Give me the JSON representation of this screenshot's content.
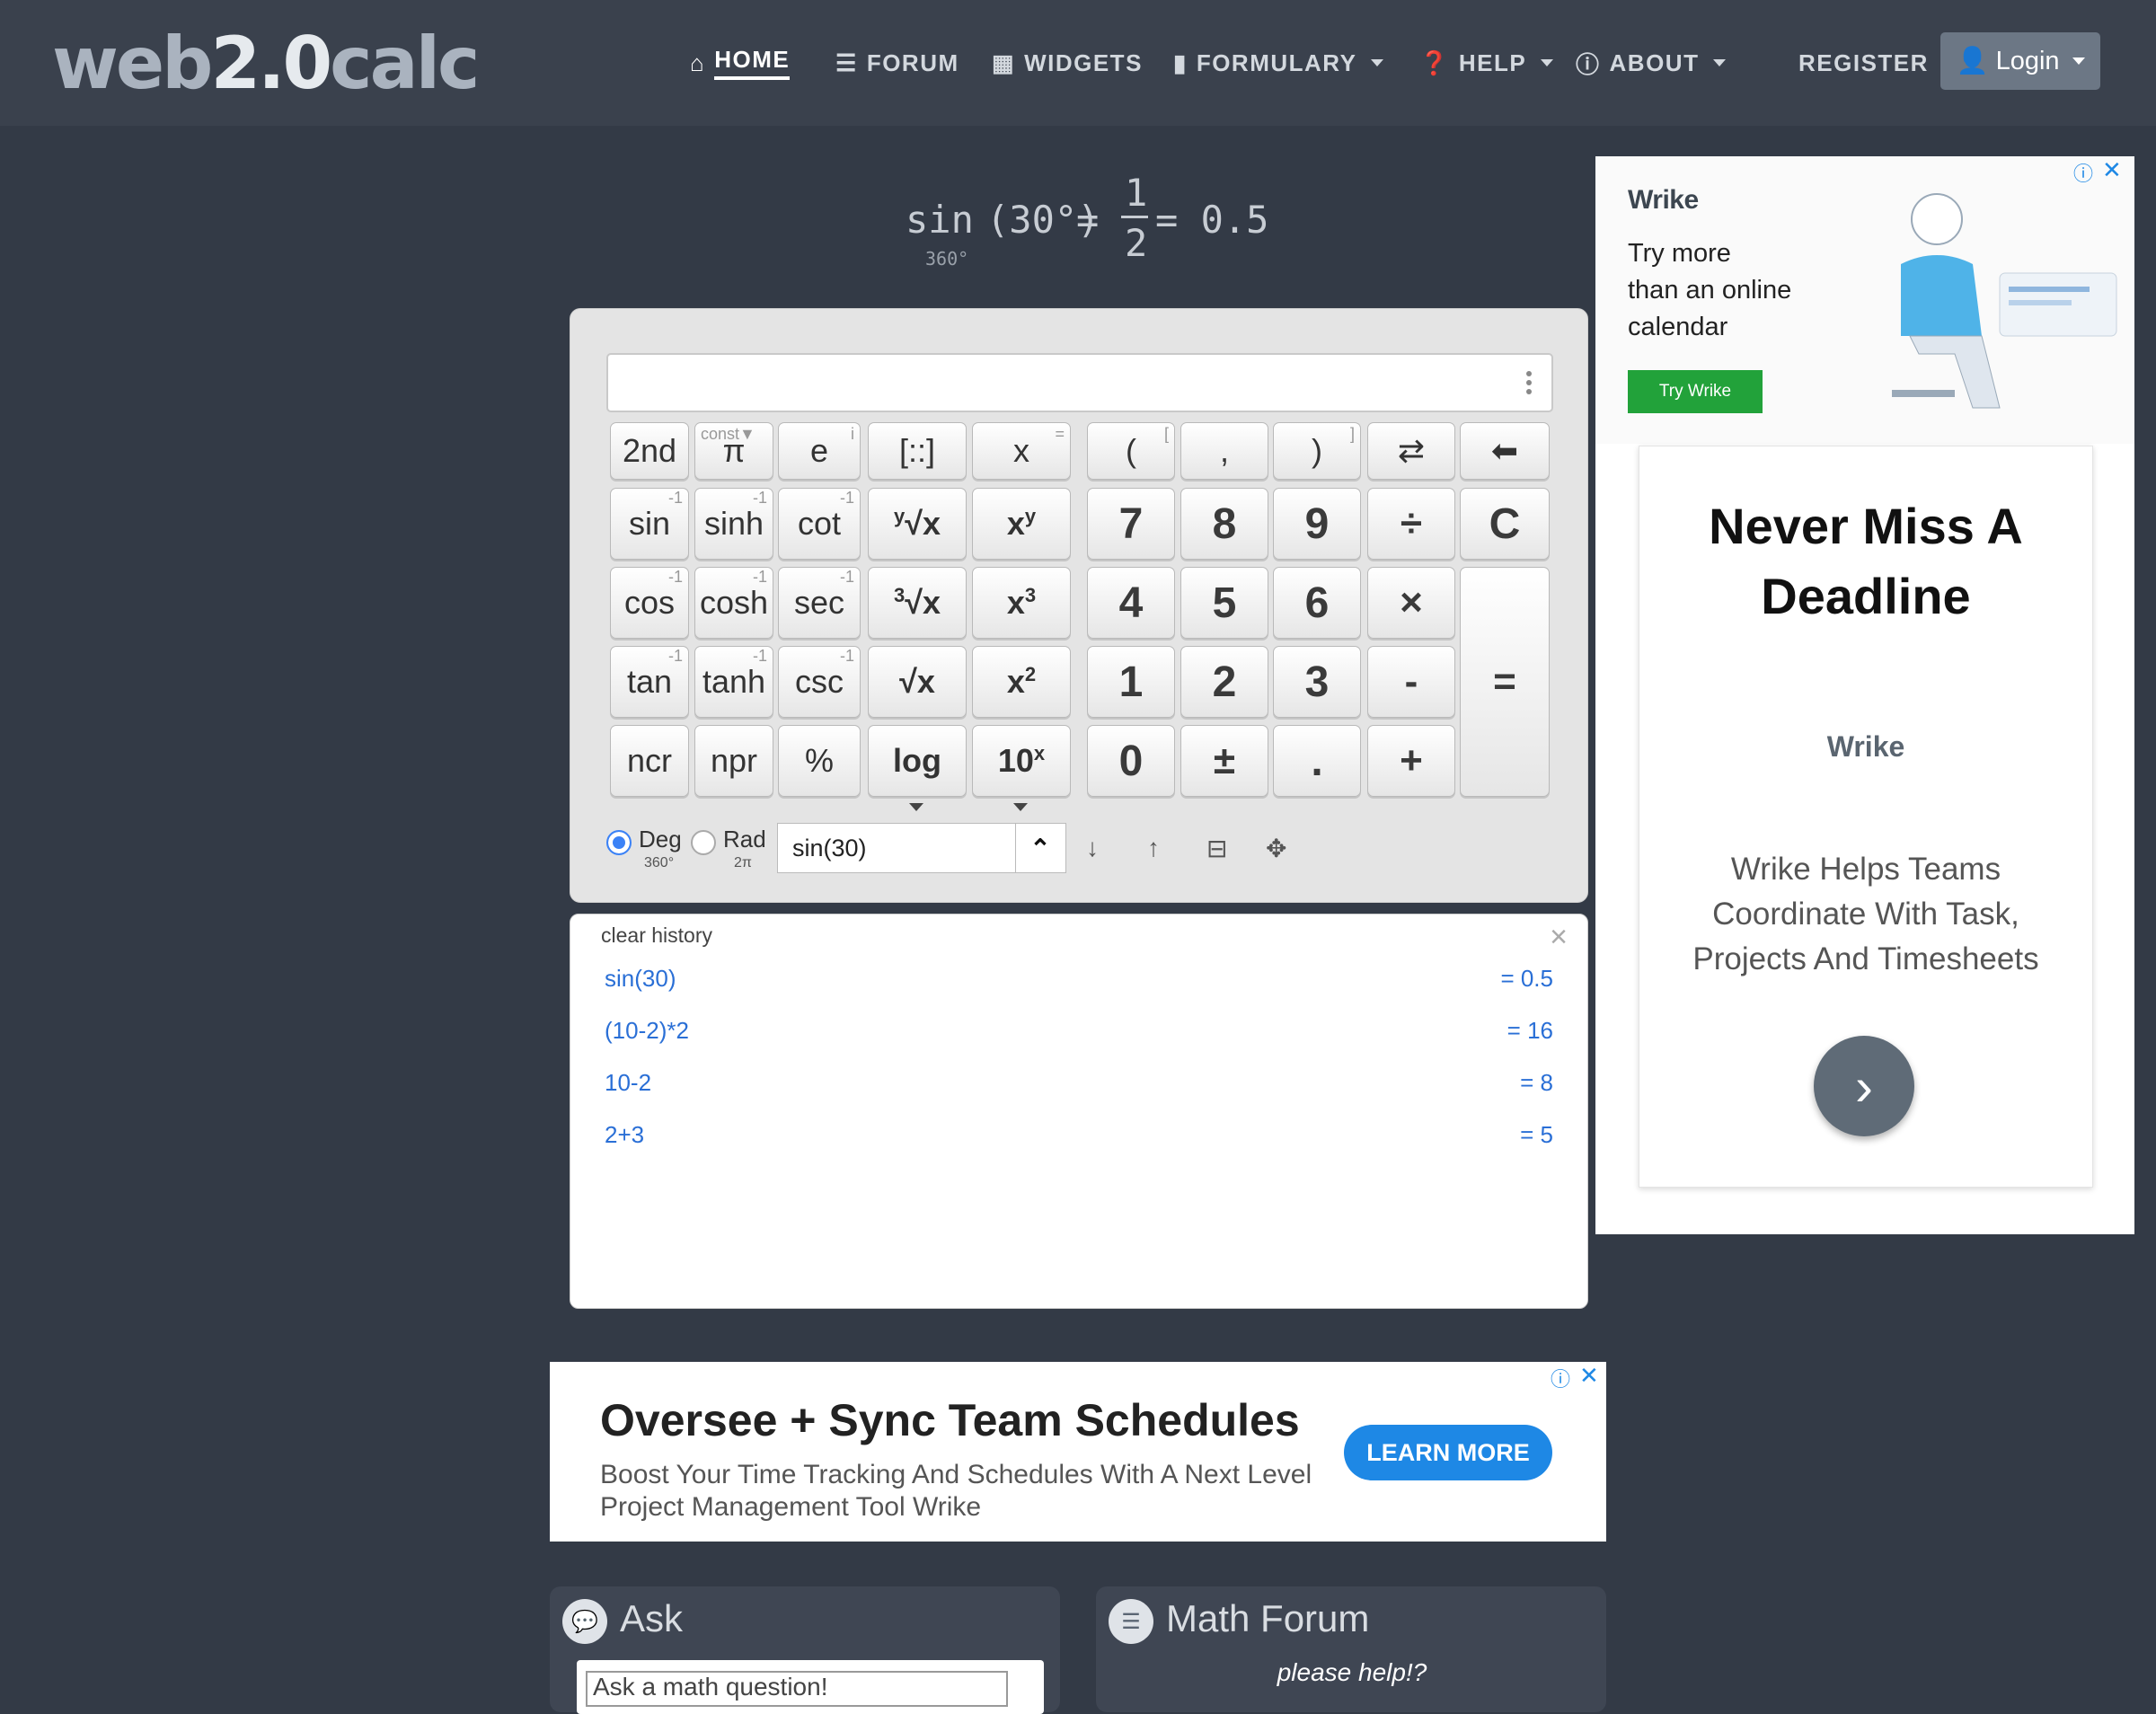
{
  "nav": {
    "logo_a": "web",
    "logo_b": "2.0",
    "logo_c": "calc",
    "items": [
      {
        "label": "HOME",
        "icon": "home-icon",
        "active": true
      },
      {
        "label": "FORUM",
        "icon": "list-icon"
      },
      {
        "label": "WIDGETS",
        "icon": "calendar-icon"
      },
      {
        "label": "FORMULARY",
        "icon": "book-icon"
      },
      {
        "label": "HELP",
        "icon": "question-circle-icon"
      },
      {
        "label": "ABOUT",
        "icon": "info-circle-icon"
      }
    ],
    "register": "REGISTER",
    "login": "Login"
  },
  "result": {
    "fn": "sin",
    "arg": "(30°)",
    "eq1": "=",
    "num": "1",
    "den": "2",
    "eq2": "= 0.5",
    "mode_sub": "360°"
  },
  "calc": {
    "input_value": "",
    "keys": {
      "second": "2nd",
      "const_mark": "const▼",
      "pi": "π",
      "e": "e",
      "matrix": "[::]",
      "x": "x",
      "lparen": "(",
      "comma": ",",
      "rparen": ")",
      "swap": "⇄",
      "back": "⬅",
      "sin": "sin",
      "sinh": "sinh",
      "cot": "cot",
      "yroot_y": "y",
      "yroot": "√x",
      "xy_x": "x",
      "xy_y": "y",
      "cos": "cos",
      "cosh": "cosh",
      "sec": "sec",
      "croot_3": "3",
      "croot": "√x",
      "x3_x": "x",
      "x3_3": "3",
      "tan": "tan",
      "tanh": "tanh",
      "csc": "csc",
      "sqrt": "√x",
      "x2_x": "x",
      "x2_2": "2",
      "ncr": "ncr",
      "npr": "npr",
      "percent": "%",
      "log": "log",
      "tenx_10": "10",
      "tenx_x": "x",
      "n7": "7",
      "n8": "8",
      "n9": "9",
      "div": "÷",
      "clear": "C",
      "n4": "4",
      "n5": "5",
      "n6": "6",
      "mul": "×",
      "n1": "1",
      "n2": "2",
      "n3": "3",
      "minus": "-",
      "equals": "=",
      "n0": "0",
      "pm": "±",
      "dot": ".",
      "plus": "+",
      "inv": "-1",
      "x_mark": "=",
      "e_mark": "i",
      "lbr": "[",
      "rbr": "]"
    },
    "deg_label": "Deg",
    "deg_sub": "360°",
    "rad_label": "Rad",
    "rad_sub": "2π",
    "expression": "sin(30)"
  },
  "history": {
    "clear_label": "clear history",
    "rows": [
      {
        "expr": "sin(30)",
        "result": "= 0.5"
      },
      {
        "expr": "(10-2)*2",
        "result": "= 16"
      },
      {
        "expr": "10-2",
        "result": "= 8"
      },
      {
        "expr": "2+3",
        "result": "= 5"
      }
    ]
  },
  "side_ad": {
    "brand": "Wrike",
    "line1": "Try more",
    "line2": "than an online",
    "line3": "calendar",
    "cta": "Try Wrike",
    "headline1": "Never Miss A",
    "headline2": "Deadline",
    "card_brand": "Wrike",
    "body1": "Wrike Helps Teams",
    "body2": "Coordinate With Task,",
    "body3": "Projects And Timesheets"
  },
  "bottom_ad": {
    "title": "Oversee + Sync Team Schedules",
    "desc1": "Boost Your Time Tracking And Schedules With A Next Level",
    "desc2": "Project Management Tool Wrike",
    "cta": "LEARN MORE"
  },
  "panels": {
    "ask_title": "Ask",
    "ask_placeholder": "Ask a math question!",
    "forum_title": "Math Forum",
    "forum_link": "please help!?"
  },
  "colors": {
    "page_bg": "#333a46",
    "navbar_bg": "#3a414d",
    "history_link": "#2a6fd6",
    "ad_button_green": "#22a23a",
    "ad_button_blue": "#1e88e5"
  }
}
